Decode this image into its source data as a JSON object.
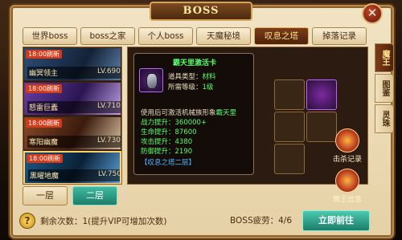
{
  "window": {
    "title": "BOSS"
  },
  "tabs": [
    {
      "label": "世界boss",
      "active": false
    },
    {
      "label": "boss之家",
      "active": false
    },
    {
      "label": "个人boss",
      "active": false
    },
    {
      "label": "天魔秘境",
      "active": false
    },
    {
      "label": "叹息之塔",
      "active": true
    },
    {
      "label": "掉落记录",
      "active": false
    }
  ],
  "side_tabs": [
    {
      "label": "魔王",
      "active": true
    },
    {
      "label": "图鉴",
      "active": false
    },
    {
      "label": "灵珠",
      "active": false
    }
  ],
  "boss_list": [
    {
      "refresh": "18:00刷新",
      "name": "幽冥领主",
      "level": "LV.690",
      "selected": false
    },
    {
      "refresh": "18:00刷新",
      "name": "怒雷巨蠹",
      "level": "LV.710",
      "selected": false
    },
    {
      "refresh": "18:00刷新",
      "name": "寒阳幽魔",
      "level": "LV.730",
      "selected": false
    },
    {
      "refresh": "18:00刷新",
      "name": "黑曜地魔",
      "level": "LV.750",
      "selected": true
    }
  ],
  "floors": [
    {
      "label": "一层",
      "active": false
    },
    {
      "label": "二层",
      "active": true
    }
  ],
  "tooltip": {
    "title": "霸天里激活卡",
    "type_label": "道具类型：",
    "type_value": "材料",
    "level_label": "所需等级：",
    "level_value": "1级",
    "desc_prefix": "使用后可激活机械族形象",
    "desc_highlight": "霸天里",
    "stats": [
      "战力提升：360000+",
      "生命提升：87600",
      "攻击提升：4380",
      "防御提升：2190"
    ],
    "source": "【叹息之塔二层】"
  },
  "right_actions": [
    {
      "label": "击杀记录",
      "icon": "skull-emblem-icon"
    },
    {
      "label": "魔王信息",
      "icon": "demon-emblem-icon"
    }
  ],
  "bottom": {
    "help": "?",
    "remaining": "剩余次数：1(提升VIP可增加次数)",
    "fatigue": "BOSS疲劳：4/6",
    "go_button": "立即前往"
  },
  "colors": {
    "accent": "#ffd36a",
    "teal": "#2a9c86",
    "green_text": "#58ff6a",
    "blue_text": "#4fb7ff"
  }
}
